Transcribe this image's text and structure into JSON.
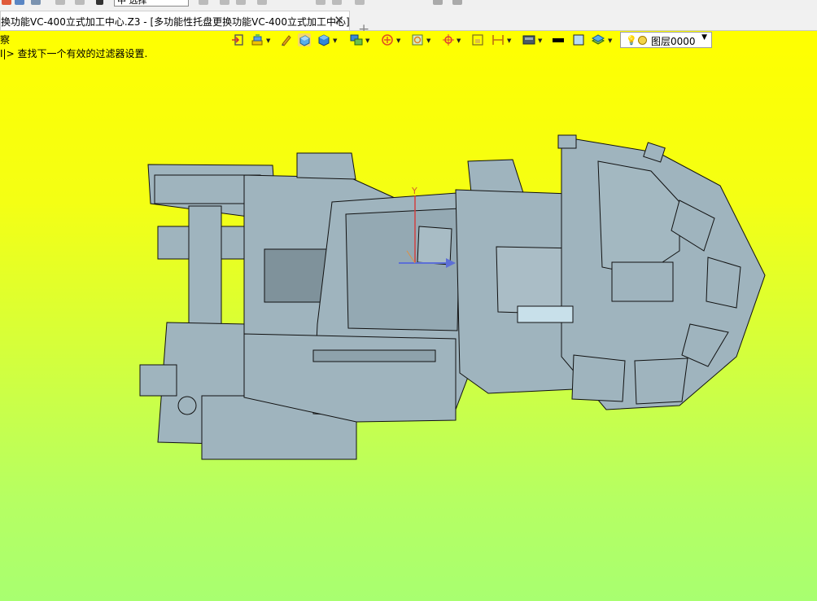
{
  "quick_access": {
    "mode_prefix": "中",
    "mode_value": "选择"
  },
  "tab": {
    "title": "换功能VC-400立式加工中心.Z3 - [多功能性托盘更换功能VC-400立式加工中心]",
    "close_glyph": "✕",
    "new_tab_glyph": "+"
  },
  "viewport": {
    "mode_label": "察",
    "status_message": "I|> 查找下一个有效的过滤器设置.",
    "background_top": "#ffff00",
    "background_bottom": "#a8ff70",
    "model_color": "#9fb4be",
    "edge_color": "#111111"
  },
  "toolbar": {
    "layer_label": "图层0000"
  },
  "axis": {
    "y_label": "Y"
  }
}
